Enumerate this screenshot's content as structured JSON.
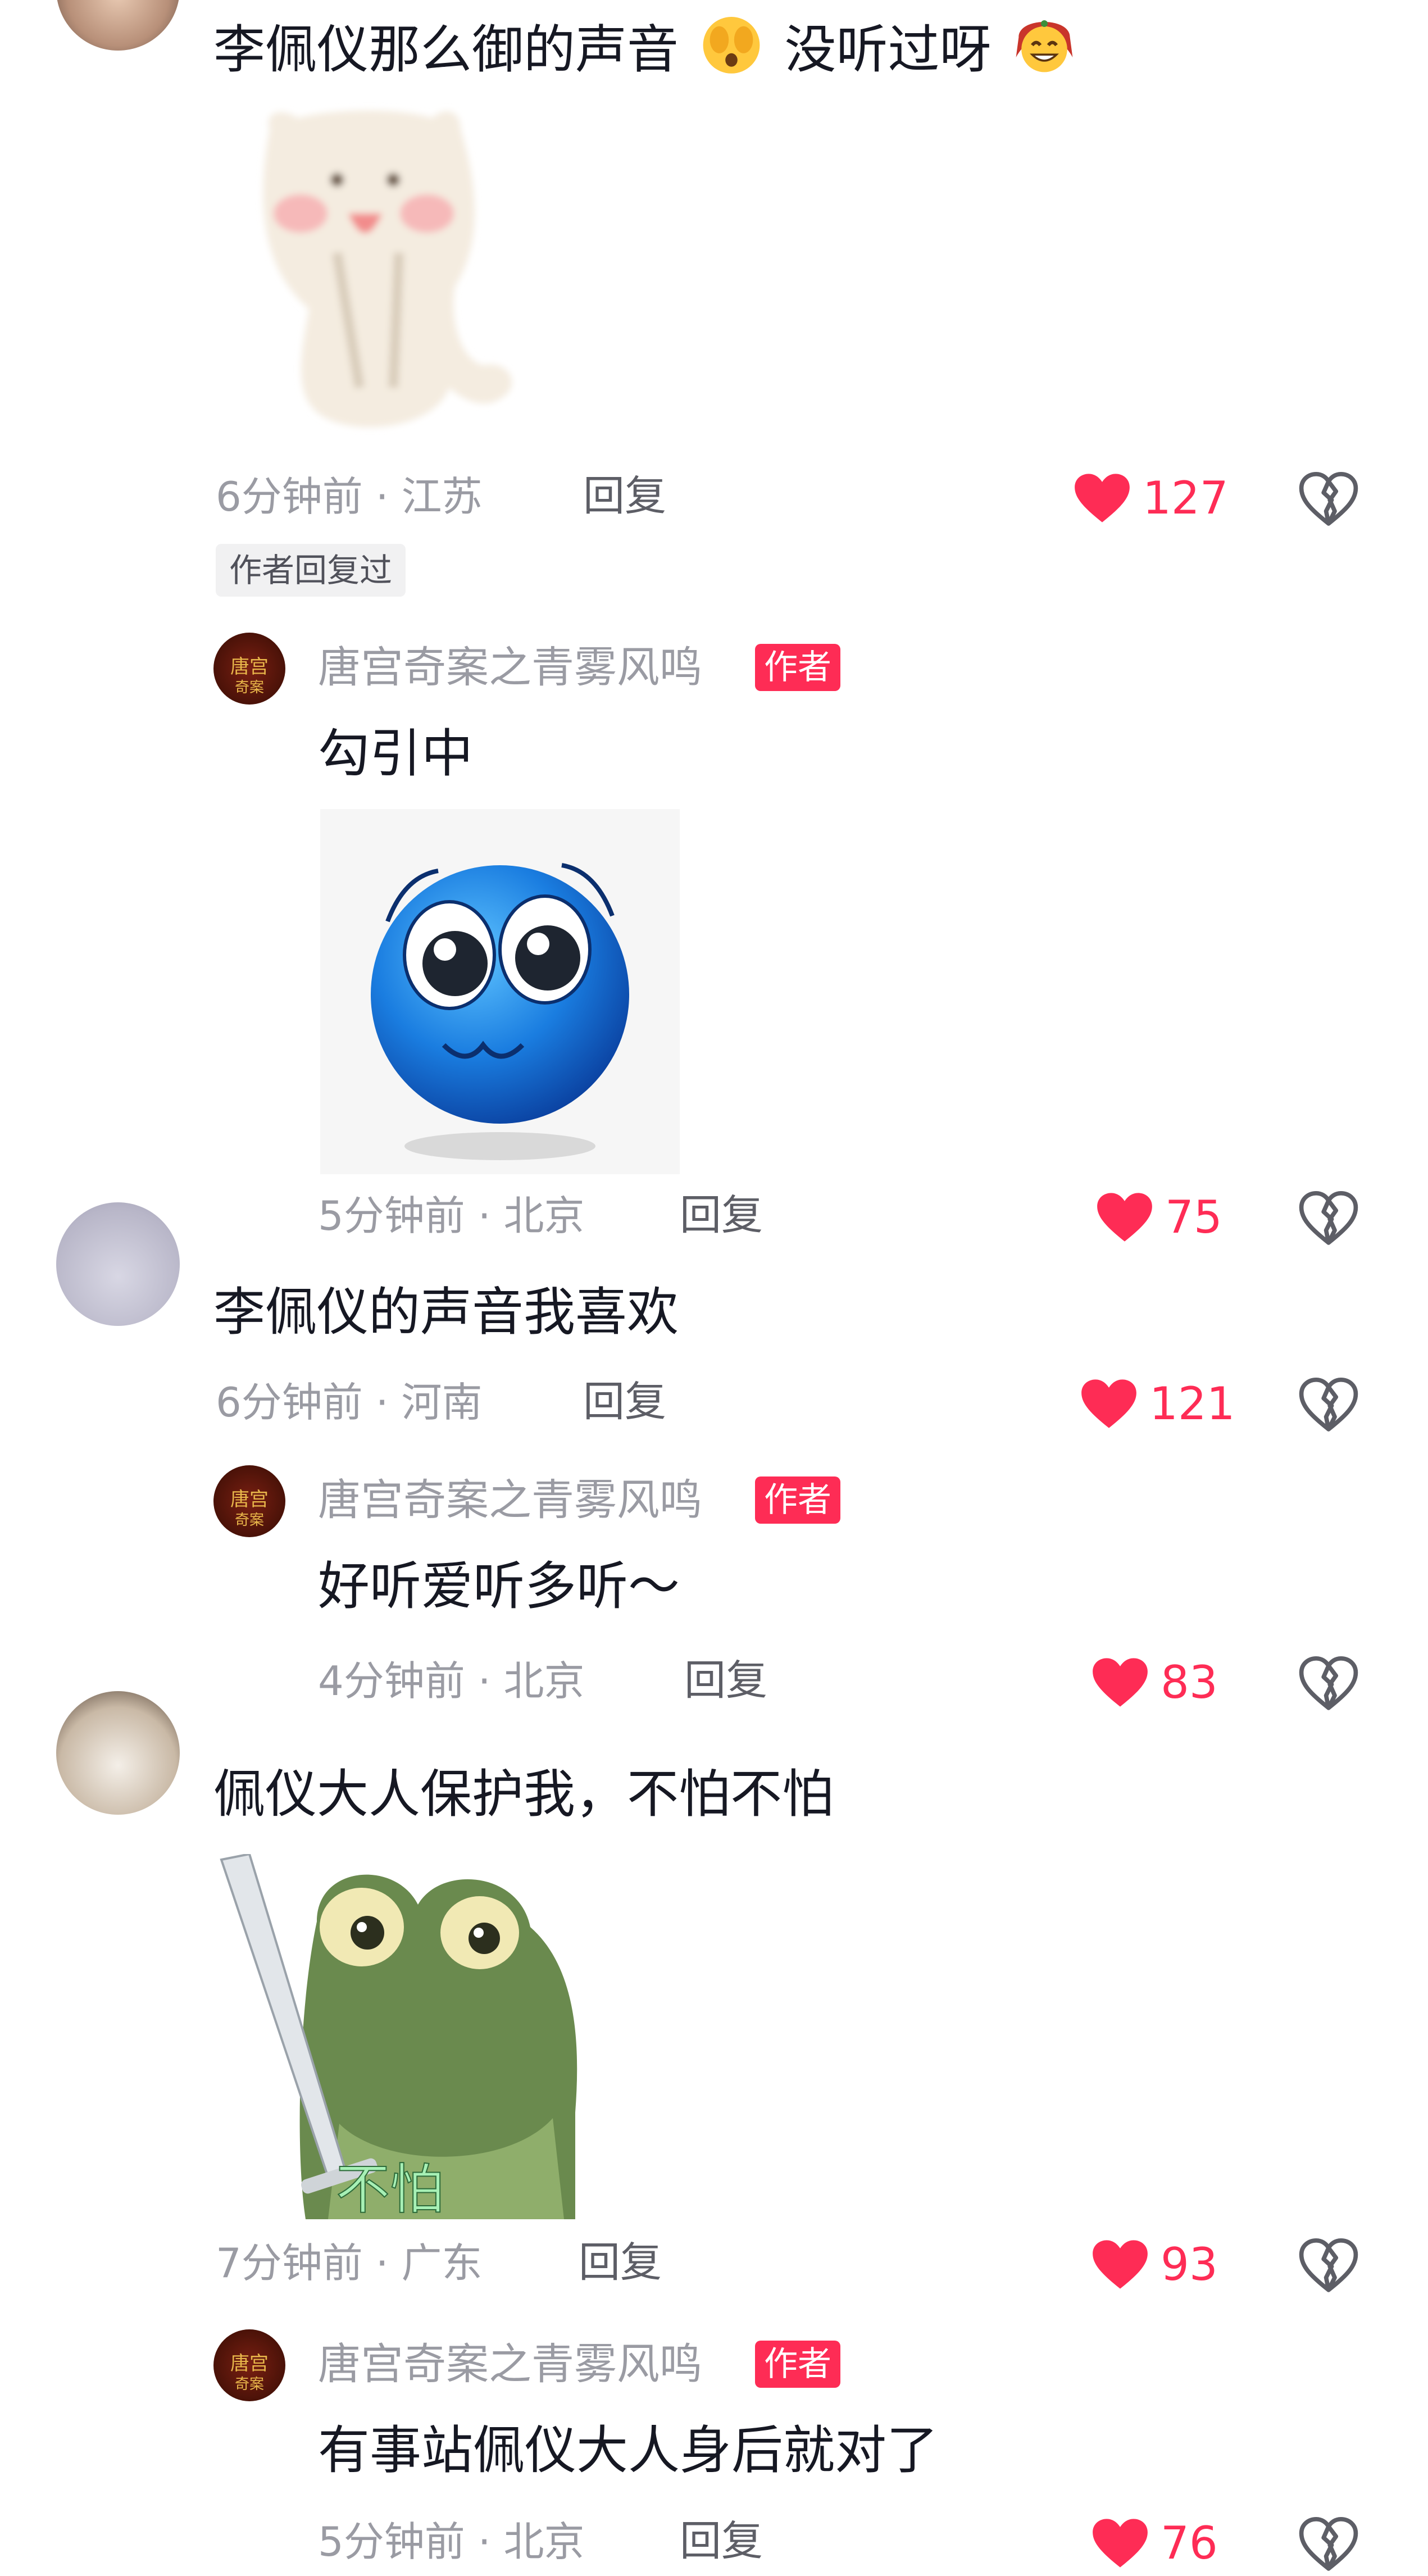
{
  "comments": [
    {
      "text": "李佩仪那么御的声音",
      "text_after": "没听过呀",
      "time": "6分钟前 · 江苏",
      "reply_label": "回复",
      "likes": "127",
      "badge": "作者回复过",
      "reply": {
        "username": "唐宫奇案之青雾风鸣",
        "badge": "作者",
        "text": "勾引中",
        "time": "5分钟前 · 北京",
        "reply_label": "回复",
        "likes": "75"
      }
    },
    {
      "text": "李佩仪的声音我喜欢",
      "time": "6分钟前 · 河南",
      "reply_label": "回复",
      "likes": "121",
      "reply": {
        "username": "唐宫奇案之青雾风鸣",
        "badge": "作者",
        "text": "好听爱听多听～",
        "time": "4分钟前 · 北京",
        "reply_label": "回复",
        "likes": "83"
      }
    },
    {
      "text": "佩仪大人保护我，不怕不怕",
      "sticker_caption": "不怕",
      "time": "7分钟前 · 广东",
      "reply_label": "回复",
      "likes": "93",
      "reply": {
        "username": "唐宫奇案之青雾风鸣",
        "badge": "作者",
        "text": "有事站佩仪大人身后就对了",
        "time": "5分钟前 · 北京",
        "reply_label": "回复",
        "likes": "76"
      }
    }
  ],
  "icons": {
    "like": "heart-icon",
    "dislike": "broken-heart-icon",
    "emoji_shy": "shy-face-emoji-icon",
    "emoji_grin": "grinning-face-emoji-icon"
  },
  "colors": {
    "accent": "#fe2c55",
    "meta": "#9a9ba3",
    "text": "#161823"
  }
}
